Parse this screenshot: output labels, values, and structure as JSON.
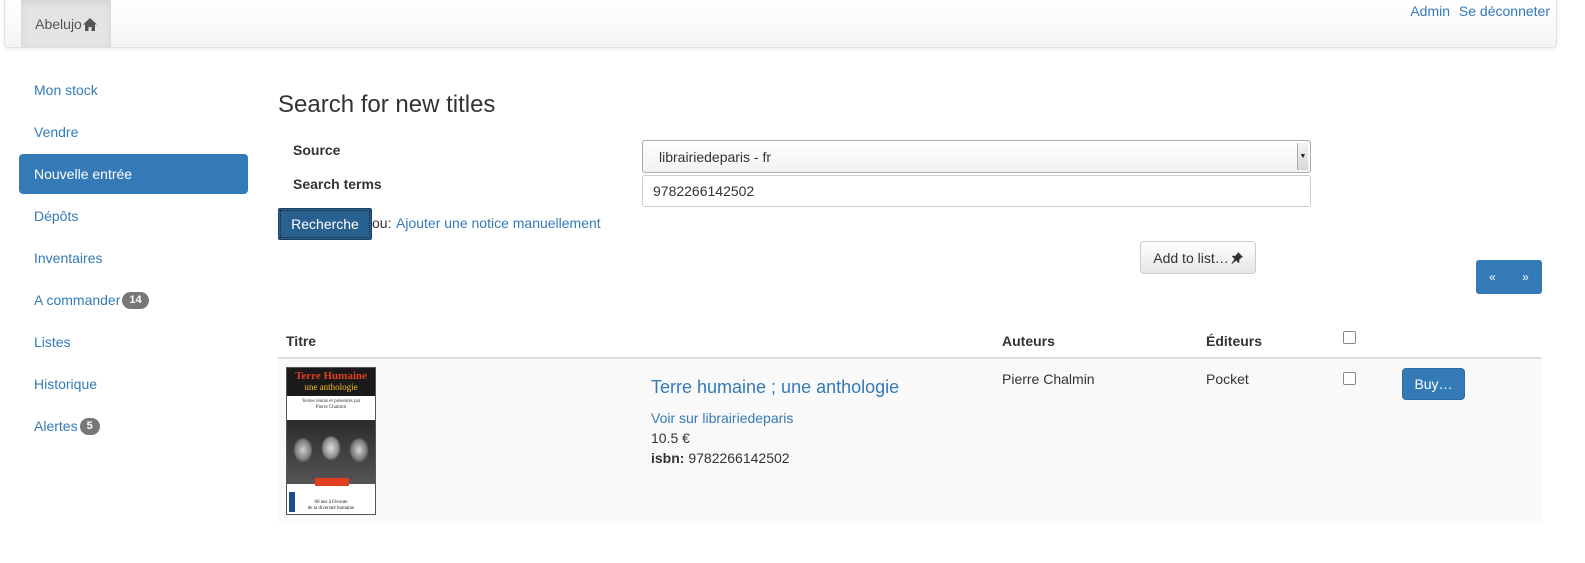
{
  "navbar": {
    "brand": "Abelujo",
    "brand_icon": "home-icon",
    "admin_label": "Admin",
    "logout_label": "Se déconneter"
  },
  "sidebar": {
    "items": [
      {
        "label": "Mon stock",
        "active": false
      },
      {
        "label": "Vendre",
        "active": false
      },
      {
        "label": "Nouvelle entrée",
        "active": true
      },
      {
        "label": "Dépôts",
        "active": false
      },
      {
        "label": "Inventaires",
        "active": false
      },
      {
        "label": "A commander",
        "badge": "14",
        "active": false
      },
      {
        "label": "Listes",
        "active": false
      },
      {
        "label": "Historique",
        "active": false
      },
      {
        "label": "Alertes",
        "badge": "5",
        "active": false
      }
    ]
  },
  "search": {
    "title": "Search for new titles",
    "source_label": "Source",
    "source_value": "librairiedeparis - fr",
    "terms_label": "Search terms",
    "terms_value": "9782266142502",
    "search_button": "Recherche",
    "or_text": "ou:",
    "manual_link": "Ajouter une notice manuellement"
  },
  "toolbar": {
    "add_to_list": "Add to list…",
    "add_to_list_icon": "pin-icon",
    "pager_prev": "«",
    "pager_next": "»"
  },
  "table": {
    "headers": {
      "title": "Titre",
      "authors": "Auteurs",
      "publishers": "Éditeurs"
    },
    "rows": [
      {
        "cover": {
          "head": "Terre Humaine",
          "subhead": "une anthologie",
          "subtitle_line1": "Textes réunis et présentés par",
          "subtitle_line2": "Pierre Chalmin",
          "footer_line1": "60 ans à l'écoute",
          "footer_line2": "de la diversité humaine"
        },
        "title": "Terre humaine ; une anthologie",
        "source_link": "Voir sur librairiedeparis",
        "price": "10.5 €",
        "isbn_label": "isbn:",
        "isbn": "9782266142502",
        "author": "Pierre Chalmin",
        "publisher": "Pocket",
        "buy_label": "Buy…"
      }
    ]
  },
  "colors": {
    "primary": "#337ab7",
    "primary_dark": "#286090",
    "badge": "#777777"
  }
}
